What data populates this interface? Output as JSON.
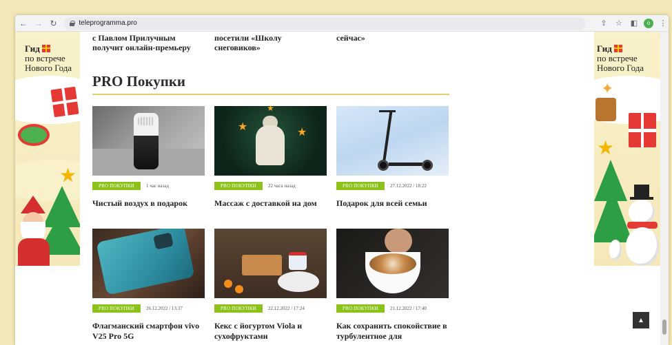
{
  "browser": {
    "url": "teleprogramma.pro",
    "profile_initial": "o"
  },
  "banner": {
    "line1": "Гид",
    "line2": "по встрече",
    "line3": "Нового Года"
  },
  "top_titles": [
    {
      "text": "с Павлом Прилучным получит онлайн-премьеру"
    },
    {
      "text": "посетили «Школу снеговиков»"
    },
    {
      "text": "сейчас»"
    }
  ],
  "section": {
    "title": "PRO Покупки"
  },
  "cards": [
    {
      "tag": "PRO ПОКУПКИ",
      "date": "1 час назад",
      "title": "Чистый воздух в подарок"
    },
    {
      "tag": "PRO ПОКУПКИ",
      "date": "22 часа назад",
      "title": "Массаж с доставкой на дом"
    },
    {
      "tag": "PRO ПОКУПКИ",
      "date": "27.12.2022 / 18:22",
      "title": "Подарок для всей семьи"
    },
    {
      "tag": "PRO ПОКУПКИ",
      "date": "26.12.2022 / 13:37",
      "title": "Флагманский смартфон vivo V25 Pro 5G"
    },
    {
      "tag": "PRO ПОКУПКИ",
      "date": "22.12.2022 / 17:24",
      "title": "Кекс с йогуртом Viola и сухофруктами"
    },
    {
      "tag": "PRO ПОКУПКИ",
      "date": "21.12.2022 / 17:40",
      "title": "Как сохранить спокойствие в турбулентное для"
    }
  ],
  "colors": {
    "tag_green": "#8cc21a",
    "underline_gold": "#e2cf6a",
    "banner_cream": "#f8f1c9"
  },
  "icons": {
    "back": "arrow-left-icon",
    "forward": "arrow-right-icon",
    "reload": "reload-icon",
    "lock": "lock-icon",
    "share": "share-icon",
    "bookmark": "star-icon",
    "sidepanel": "side-panel-icon",
    "menu": "kebab-menu-icon",
    "to_top": "chevron-up-icon"
  }
}
